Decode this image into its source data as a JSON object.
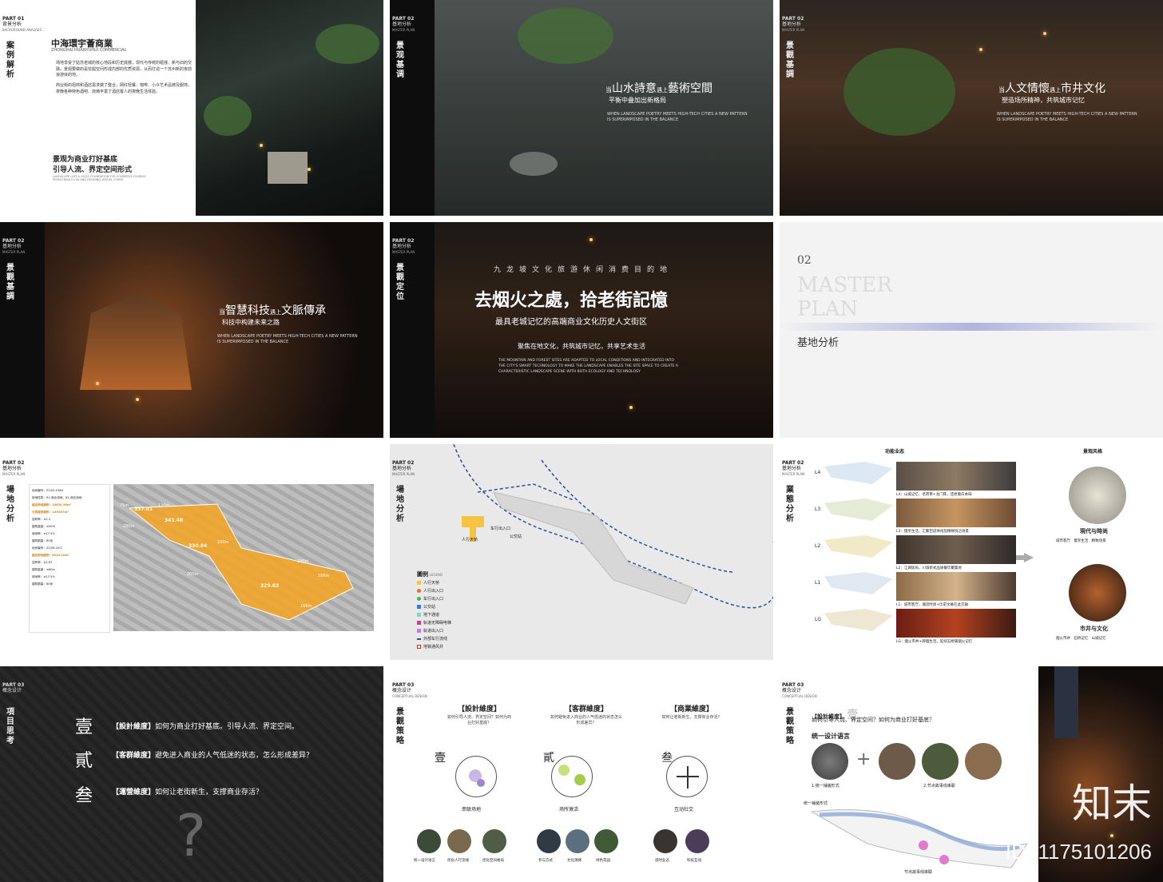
{
  "colors": {
    "orange": "#f5a623",
    "dark": "#111111",
    "blueline": "#2a4ea0"
  },
  "s1": {
    "part": "PART 01",
    "part_cn": "背景分析",
    "part_en": "BACKGROUND ANALYSIS",
    "vtitle": "案例解析",
    "title": "中海環宇薈商業",
    "title_en": "ZHONGHAI HUANYUHUI COMMERCIAL",
    "bullet1": "场地享受了姑苏老城的核心地段和历史底蕴，现代与传统的碰撞、新与旧的交融。景观要做的是挖掘空间形成内部的优质资源，从而打造一个苏州新的夜前浪游目的地。",
    "bullet2": "商业街的招商和酒店需求做了整合，网红轻餐、咖啡、小众艺术品牌及服饰，夜晚各种特色酒吧、烧烤丰富了酒店客人的夜晚生活体验。",
    "slogan1": "景观为商业打好基底",
    "slogan2": "引导人流、界定空间形式",
    "slogan_en": "LANDSCAPE LAYS A SOLID FOUNDATION FOR COMMERCE GUIDING PEDESTRIAN FLOW AND DEFINING SPATIAL FORMS"
  },
  "s2": {
    "part": "PART 02",
    "part_cn": "基地分析",
    "part_en": "MASTER PLAN",
    "vtitle": "景观基调",
    "pre": "当",
    "a": "山水詩意",
    "mid": "遇上",
    "b": "藝術空間",
    "sub": "平衡中叠加出新格局",
    "en": "WHEN LANDSCAPE POETRY MEETS HIGH-TECH CITIES A NEW PATTERN IS SUPERIMPOSED IN THE BALANCE"
  },
  "s3": {
    "part": "PART 02",
    "part_cn": "基地分析",
    "part_en": "MASTER PLAN",
    "vtitle": "景觀基調",
    "pre": "当",
    "a": "人文情懷",
    "mid": "遇上",
    "b": "市井文化",
    "sub": "塑造场所精神，共筑城市记忆",
    "en": "WHEN LANDSCAPE POETRY MEETS HIGH-TECH CITIES A NEW PATTERN IS SUPERIMPOSED IN THE BALANCE"
  },
  "s4": {
    "part": "PART 02",
    "part_cn": "基地分析",
    "part_en": "MASTER PLAN",
    "vtitle": "景觀基調",
    "pre": "当",
    "a": "智慧科技",
    "mid": "遇上",
    "b": "文脈傳承",
    "sub": "科技中构建未来之路",
    "en": "WHEN LANDSCAPE POETRY MEETS HIGH-TECH CITIES A NEW PATTERN IS SUPERIMPOSED IN THE BALANCE"
  },
  "s5": {
    "part": "PART 02",
    "part_cn": "基地分析",
    "part_en": "MASTER PLAN",
    "vtitle": "景觀定位",
    "top": "九龙坡文化旅游休闲消费目的地",
    "title": "去烟火之處，拾老街記憶",
    "sub": "最具老城记忆的高端商业文化历史人文街区",
    "line": "聚焦在地文化，共筑城市记忆，共享艺术生活",
    "en": "THE MOUNTAIN AND FOREST SITES ARE ADAPTED TO LOCAL CONDITIONS AND INTEGRATED INTO THE CITY'S SMART TECHNOLOGY TO MAKE THE LANDSCAPE ENABLES THE SITE SPACE TO CREATE A CHARACTERISTIC LANDSCAPE SCENE WITH BOTH ECOLOGY AND TECHNOLOGY"
  },
  "s6": {
    "num": "02",
    "en1": "MASTER",
    "en2": "PLAN",
    "cn": "基地分析"
  },
  "s7": {
    "part": "PART 02",
    "part_cn": "基地分析",
    "part_en": "MASTER PLAN",
    "vtitle": "場地分析",
    "labels": [
      "75m",
      "120m",
      "280m",
      "230m",
      "200m",
      "230m",
      "166m",
      "166m"
    ],
    "elev": [
      "337.01",
      "341.48",
      "330.84",
      "329.83"
    ],
    "info": [
      "地块编号：Z1/05-0380",
      "用地性质：R1-商业用地，B1-商业用地",
      "建设用地面积：19630.36m²",
      "计容建筑面积：≤39557m²",
      "容积率：≤2.2",
      "建筑高度：≤50m",
      "绿地率：≥17.5%",
      "建筑限高：80米",
      "地块编号：Z2/06-3/07",
      "建设用地面积：6010.20m²",
      "容积率：≤2.87",
      "建筑高度：≤80m",
      "绿地率：≥17.5%",
      "建筑限高：80米"
    ]
  },
  "s8": {
    "part": "PART 02",
    "part_cn": "基地分析",
    "part_en": "MASTER PLAN",
    "vtitle": "場地分析",
    "legend_title": "圖例",
    "legend_en": "LEGEND",
    "legend": [
      "人行天桥",
      "人行出入口",
      "车行出入口",
      "公交站",
      "地下通道",
      "轨道无障碍电梯",
      "轨道出入口",
      "外部车行流线",
      "地铁通风井"
    ],
    "map_labels": [
      "人行天桥",
      "车行出入口",
      "公交站"
    ]
  },
  "s9": {
    "part": "PART 02",
    "part_cn": "基地分析",
    "part_en": "MASTER PLAN",
    "vtitle": "業態分析",
    "h1": "功能业态",
    "h2": "景观风格",
    "levels": [
      "L4",
      "L3",
      "L2",
      "L1",
      "LG"
    ],
    "desc": [
      "L4：山城记忆、老荷茶+龙门阵，还原重庆本味",
      "L3：慢享生活，汇聚巴适休闲及精致悦己场景",
      "L2：江湖饭局，川渝新式品质餐饮聚集地",
      "L1：城市客厅，潮流时尚+历史文脉在此交融",
      "LG：烟火市井+辨烟生活，延续石桥铺烟火记忆"
    ],
    "style1": "現代与時尚",
    "style1_tags": [
      "城市客厅",
      "慢享生活",
      "精致场景"
    ],
    "style2": "市井与文化",
    "style2_tags": [
      "烟火市井",
      "石桥记忆",
      "山城记忆"
    ]
  },
  "s10": {
    "part": "PART 03",
    "part_cn": "概念设计",
    "vtitle": "項目思考",
    "n1": "壹",
    "n2": "貳",
    "n3": "叁",
    "q1k": "【設計維度】",
    "q1": "如何为商业打好基底。引导人流、界定空间。",
    "q2k": "【客群維度】",
    "q2": "避免进入商业的人气低迷的状态，怎么形成差异？",
    "q3k": "【運營維度】",
    "q3": "如何让老街新生，支撑商业存活？",
    "qmark": "?"
  },
  "s11": {
    "part": "PART 03",
    "part_cn": "概念设计",
    "part_en": "CONCEPTUAL DESIGN",
    "vtitle": "景觀策略",
    "cols": [
      {
        "head": "【設計維度】",
        "q": "如何引导人流、界定空间？如何为商业打好基底？",
        "num": "壹",
        "cap": "串联场地",
        "thumbs": [
          "统一设计语言",
          "优化人行流线",
          "优化空间格局"
        ]
      },
      {
        "head": "【客群維度】",
        "q": "如何避免进入商业的人气低迷的状态怎么形成差异？",
        "num": "貳",
        "cap": "场所激活",
        "thumbs": [
          "参与方式",
          "文化演绎",
          "绿色花园"
        ]
      },
      {
        "head": "【商業維度】",
        "q": "如何让老街新生，支撑商业存活？",
        "num": "叁",
        "cap": "互动社交",
        "thumbs": [
          "适时业态",
          "科技互动"
        ]
      }
    ]
  },
  "s12": {
    "part": "PART 03",
    "part_cn": "概念设计",
    "part_en": "CONCEPTUAL DESIGN",
    "vtitle": "景觀策略",
    "head": "【設計維度】",
    "num": "壹",
    "q": "如何引导人流、界定空间？如何为商业打好基底？",
    "sub": "统一设计语言",
    "cap1": "1.统一铺装形式",
    "cap2": "2.节点故事线串联",
    "note1": "统一铺装形式",
    "note2": "节点故事线串联",
    "plus": "+"
  },
  "wm": {
    "brand": "知末",
    "id": "ID: 1175101206"
  }
}
